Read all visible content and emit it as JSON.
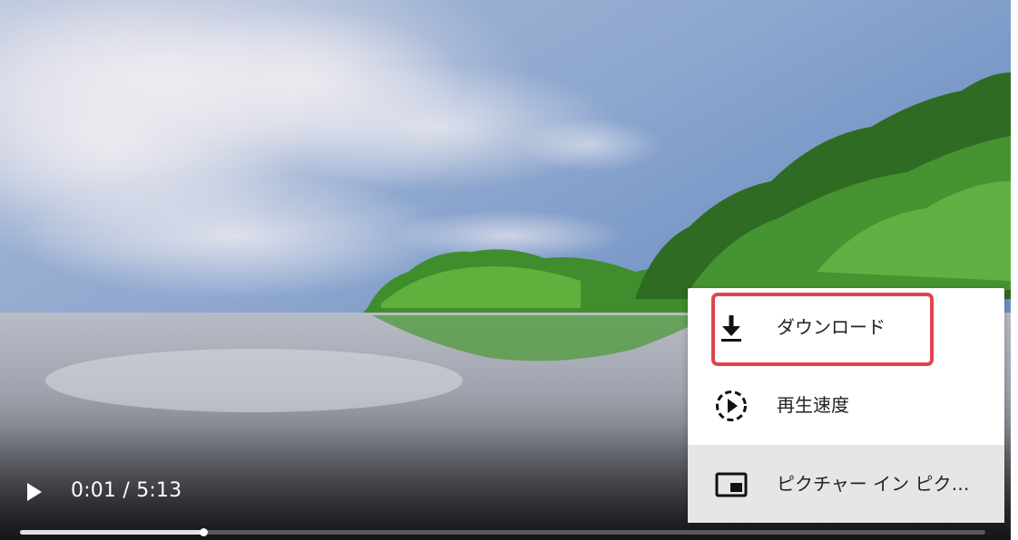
{
  "player": {
    "current_time": "0:01",
    "duration": "5:13",
    "time_display": "0:01 / 5:13",
    "progress_fraction": 0.19,
    "play_icon": "play-icon"
  },
  "menu": {
    "items": [
      {
        "label": "ダウンロード",
        "icon": "download-icon",
        "highlighted": false,
        "annotated": true
      },
      {
        "label": "再生速度",
        "icon": "playback-speed-icon",
        "highlighted": false,
        "annotated": false
      },
      {
        "label": "ピクチャー イン ピク…",
        "icon": "picture-in-picture-icon",
        "highlighted": true,
        "annotated": false
      }
    ]
  },
  "colors": {
    "annotation_box": "#e0454d",
    "menu_background": "#ffffff",
    "menu_highlight": "#e6e6e6",
    "menu_text": "#222222"
  }
}
